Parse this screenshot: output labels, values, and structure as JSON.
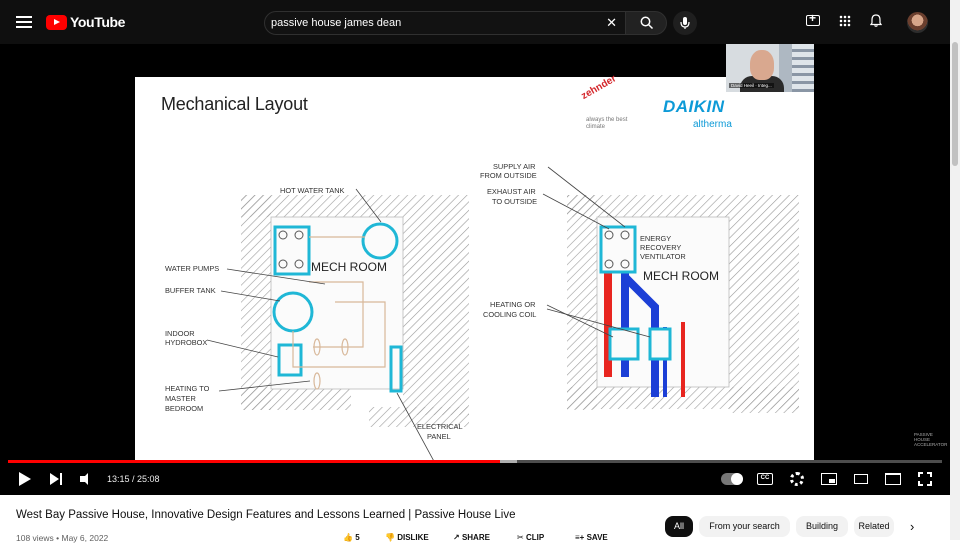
{
  "header": {
    "logo_text": "YouTube",
    "search_value": "passive house james dean",
    "clear_glyph": "✕",
    "icons": [
      "menu-icon",
      "search-icon",
      "mic-icon",
      "create-icon",
      "apps-icon",
      "bell-icon",
      "avatar"
    ]
  },
  "slide": {
    "title": "Mechanical Layout",
    "zehnder": "zehnder",
    "zehnder_tagline": "always the best climate",
    "daikin": "DAIKIN",
    "daikin_sub": "altherma",
    "left_labels": {
      "hot_water_tank": "HOT WATER TANK",
      "water_pumps": "WATER PUMPS",
      "buffer_tank": "BUFFER TANK",
      "indoor": "INDOOR",
      "hydrobox": "HYDROBOX",
      "heating_to": "HEATING TO",
      "master": "MASTER",
      "bedroom": "BEDROOM",
      "electrical": "ELECTRICAL",
      "panel": "PANEL",
      "mech_room": "MECH ROOM"
    },
    "right_labels": {
      "supply_air": "SUPPLY AIR",
      "from_outside": "FROM OUTSIDE",
      "exhaust_air": "EXHAUST AIR",
      "to_outside": "TO OUTSIDE",
      "energy": "ENERGY",
      "recovery": "RECOVERY",
      "ventilator": "VENTILATOR",
      "heating_or": "HEATING OR",
      "cooling_coil": "COOLING COIL",
      "mech_room": "MECH ROOM"
    },
    "colors": {
      "pipe_red": "#e8251f",
      "pipe_blue": "#1c3fd6",
      "equipment_cyan": "#1fb7d6",
      "hatch": "#9a9a9a"
    }
  },
  "webcam": {
    "name_tag": "David Heeil · Integ..."
  },
  "watermark": "PASSIVE HOUSE ACCELERATOR",
  "player": {
    "current_time": "13:15",
    "duration": "25:08",
    "time_display": "13:15 / 25:08",
    "progress_fraction": 0.527,
    "buffer_fraction": 0.545,
    "cc_label": "CC",
    "icons": [
      "play-icon",
      "next-icon",
      "volume-icon",
      "autoplay-toggle",
      "cc-icon",
      "settings-icon",
      "miniplayer-icon",
      "theater-icon",
      "cast-icon",
      "fullscreen-icon"
    ]
  },
  "video": {
    "title": "West Bay Passive House, Innovative Design Features and Lessons Learned | Passive House Live",
    "views_date": "108 views • May 6, 2022",
    "like_count": "5",
    "dislike": "DISLIKE",
    "share": "SHARE",
    "clip": "CLIP",
    "save": "SAVE"
  },
  "chips": [
    {
      "label": "All",
      "active": true
    },
    {
      "label": "From your search",
      "active": false
    },
    {
      "label": "Building",
      "active": false
    },
    {
      "label": "Related",
      "active": false
    }
  ],
  "chips_next_glyph": "›"
}
